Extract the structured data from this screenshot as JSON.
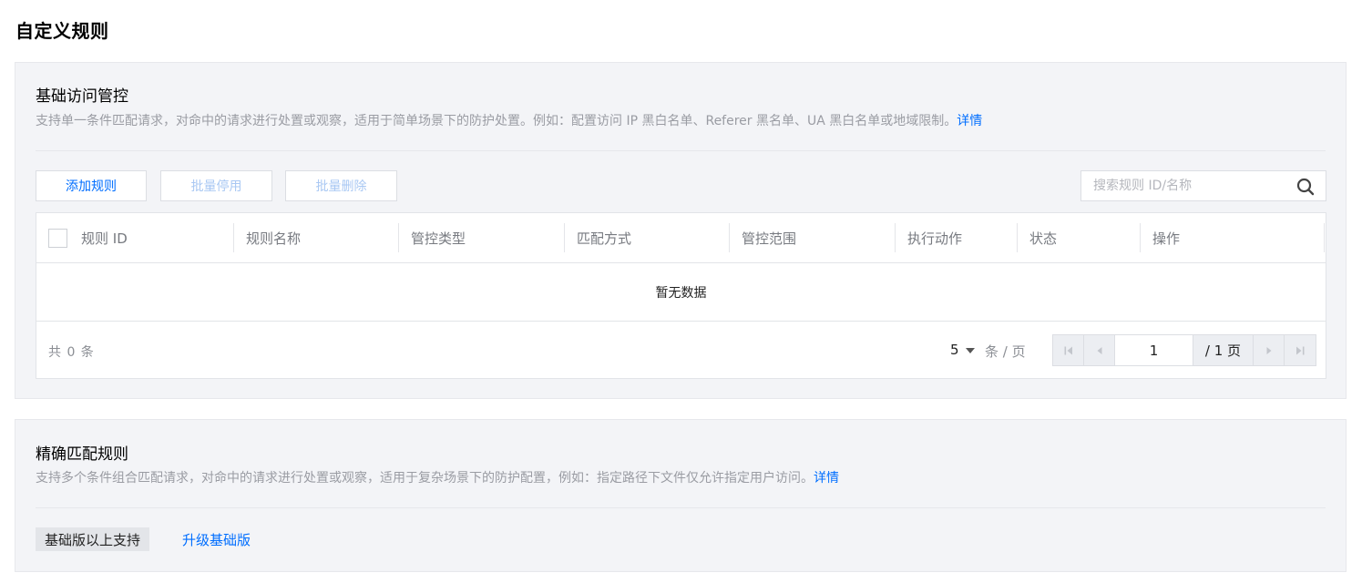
{
  "page": {
    "title": "自定义规则"
  },
  "basic": {
    "title": "基础访问管控",
    "desc": "支持单一条件匹配请求，对命中的请求进行处置或观察，适用于简单场景下的防护处置。例如：配置访问 IP 黑白名单、Referer 黑名单、UA 黑白名单或地域限制。",
    "detail_link": "详情",
    "buttons": {
      "add": "添加规则",
      "disable": "批量停用",
      "delete": "批量删除"
    },
    "search": {
      "placeholder": "搜索规则 ID/名称",
      "icon": "search-icon"
    },
    "columns": [
      "规则 ID",
      "规则名称",
      "管控类型",
      "匹配方式",
      "管控范围",
      "执行动作",
      "状态",
      "操作"
    ],
    "rows": [],
    "empty_text": "暂无数据",
    "footer": {
      "total": "共 0 条",
      "page_size": "5",
      "per_page": "条 / 页",
      "current_page": "1",
      "total_pages": "/ 1 页"
    }
  },
  "exact": {
    "title": "精确匹配规则",
    "desc": "支持多个条件组合匹配请求，对命中的请求进行处置或观察，适用于复杂场景下的防护配置，例如：指定路径下文件仅允许指定用户访问。",
    "detail_link": "详情",
    "badge": "基础版以上支持",
    "upgrade_link": "升级基础版"
  },
  "colors": {
    "accent": "#006eff",
    "card_bg": "#f3f4f7",
    "muted": "#9a9ca3"
  }
}
